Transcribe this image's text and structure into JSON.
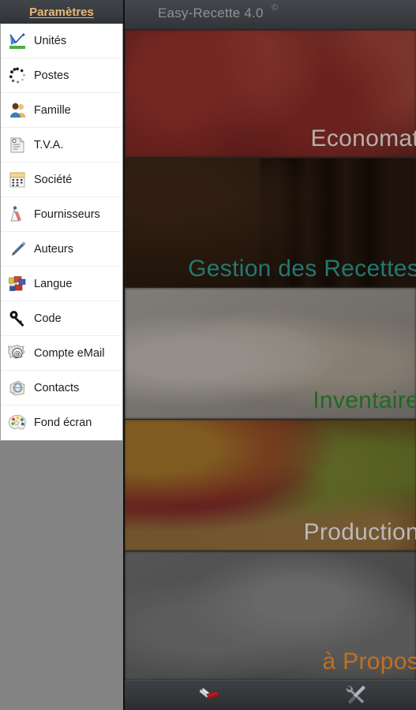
{
  "sidebar": {
    "header_title": "Paramètres",
    "items": [
      {
        "label": "Unités",
        "icon": "chart-icon"
      },
      {
        "label": "Postes",
        "icon": "spinner-dots-icon"
      },
      {
        "label": "Famille",
        "icon": "people-icon"
      },
      {
        "label": "T.V.A.",
        "icon": "documents-icon"
      },
      {
        "label": "Société",
        "icon": "building-icon"
      },
      {
        "label": "Fournisseurs",
        "icon": "supplier-icon"
      },
      {
        "label": "Auteurs",
        "icon": "pen-icon"
      },
      {
        "label": "Langue",
        "icon": "flags-icon"
      },
      {
        "label": "Code",
        "icon": "key-icon"
      },
      {
        "label": "Compte eMail",
        "icon": "email-at-icon"
      },
      {
        "label": "Contacts",
        "icon": "contacts-globe-icon"
      },
      {
        "label": "Fond écran",
        "icon": "palette-icon"
      }
    ]
  },
  "topbar": {
    "app_title": "Easy-Recette 4.0",
    "copyright_symbol": "©"
  },
  "main": {
    "panels": [
      {
        "label": "Economat",
        "label_color": "#b4b0ac",
        "image": "strawberries-photo"
      },
      {
        "label": "Gestion des Recettes",
        "label_color": "#1f7a72",
        "image": "chocolate-coffee-photo"
      },
      {
        "label": "Inventaire",
        "label_color": "#1c6b22",
        "image": "wooden-numbers-photo"
      },
      {
        "label": "Production",
        "label_color": "#b9b9b9",
        "image": "macarons-photo"
      },
      {
        "label": "à Propos",
        "label_color": "#c0701f",
        "image": "whisk-utensils-photo"
      }
    ]
  },
  "bottombar": {
    "buttons": [
      {
        "icon": "pocket-knife-icon",
        "color": "#b01f22"
      },
      {
        "icon": "tools-wrench-screwdriver-icon",
        "color": "#8b8f93"
      }
    ]
  }
}
